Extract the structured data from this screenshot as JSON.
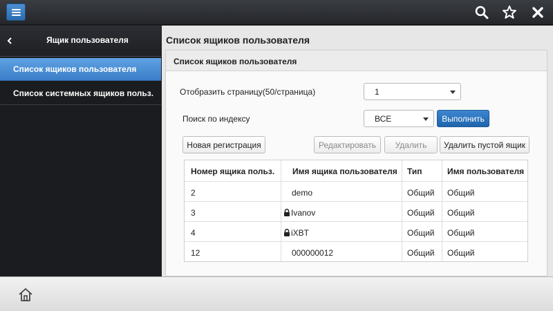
{
  "sidebar": {
    "title": "Ящик пользователя",
    "items": [
      {
        "label": "Список ящиков пользователя"
      },
      {
        "label": "Список системных ящиков польз."
      }
    ]
  },
  "main": {
    "title": "Список ящиков пользователя",
    "panel_title": "Список ящиков пользователя",
    "display_page_label": "Отобразить страницу(50/страница)",
    "display_page_value": "1",
    "index_search_label": "Поиск по индексу",
    "index_search_value": "ВСЕ",
    "execute_label": "Выполнить",
    "buttons": {
      "new_registration": "Новая регистрация",
      "edit": "Редактировать",
      "delete": "Удалить",
      "delete_empty": "Удалить пустой ящик"
    },
    "table": {
      "headers": [
        "Номер ящика польз.",
        "Имя ящика пользователя",
        "Тип",
        "Имя пользователя"
      ],
      "rows": [
        {
          "number": "2",
          "name": "demo",
          "type": "Общий",
          "user": "Общий",
          "locked": false
        },
        {
          "number": "3",
          "name": "Ivanov",
          "type": "Общий",
          "user": "Общий",
          "locked": true
        },
        {
          "number": "4",
          "name": "iXBT",
          "type": "Общий",
          "user": "Общий",
          "locked": true
        },
        {
          "number": "12",
          "name": "000000012",
          "type": "Общий",
          "user": "Общий",
          "locked": false
        }
      ]
    }
  },
  "icons": {
    "menu": "menu-icon",
    "search": "search-icon",
    "favorite": "star-icon",
    "close": "close-icon",
    "back": "chevron-left-icon",
    "lock": "lock-icon",
    "home": "home-icon"
  },
  "colors": {
    "accent": "#3b7ec8",
    "primary_button": "#1f65ad",
    "topbar": "#2e3035"
  }
}
